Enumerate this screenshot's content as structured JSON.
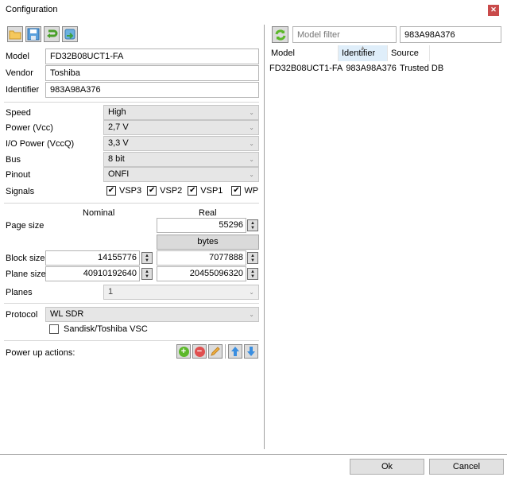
{
  "window": {
    "title": "Configuration",
    "close_icon": "close-icon"
  },
  "toolbar": {
    "buttons": [
      {
        "name": "open-button",
        "icon": "folder-open-icon"
      },
      {
        "name": "save-button",
        "icon": "floppy-disk-icon"
      },
      {
        "name": "reload-button",
        "icon": "undo-arrow-icon"
      },
      {
        "name": "import-button",
        "icon": "database-import-icon"
      }
    ]
  },
  "identity": {
    "model_label": "Model",
    "model_value": "FD32B08UCT1-FA",
    "vendor_label": "Vendor",
    "vendor_value": "Toshiba",
    "identifier_label": "Identifier",
    "identifier_value": "983A98A376"
  },
  "settings": {
    "speed_label": "Speed",
    "speed_value": "High",
    "power_label": "Power (Vcc)",
    "power_value": "2,7 V",
    "io_power_label": "I/O Power (VccQ)",
    "io_power_value": "3,3 V",
    "bus_label": "Bus",
    "bus_value": "8 bit",
    "pinout_label": "Pinout",
    "pinout_value": "ONFI",
    "signals_label": "Signals",
    "signals": [
      {
        "label": "VSP3",
        "checked": true
      },
      {
        "label": "VSP2",
        "checked": true
      },
      {
        "label": "VSP1",
        "checked": true
      },
      {
        "label": "WP",
        "checked": true
      }
    ]
  },
  "geometry": {
    "nominal_header": "Nominal",
    "real_header": "Real",
    "page_size_label": "Page size",
    "page_size_real": "55296",
    "unit_button": "bytes",
    "block_size_label": "Block size",
    "block_size_nominal": "14155776",
    "block_size_real": "7077888",
    "plane_size_label": "Plane size",
    "plane_size_nominal": "40910192640",
    "plane_size_real": "20455096320",
    "planes_label": "Planes",
    "planes_value": "1"
  },
  "protocol": {
    "label": "Protocol",
    "value": "WL SDR",
    "vsc_label": "Sandisk/Toshiba VSC",
    "vsc_checked": false
  },
  "power_up": {
    "label": "Power up actions:",
    "buttons": [
      "add-icon",
      "remove-icon",
      "edit-pencil-icon",
      "arrow-up-icon",
      "arrow-down-icon"
    ]
  },
  "database": {
    "refresh_icon": "refresh-icon",
    "model_filter_placeholder": "Model filter",
    "identifier_filter_value": "983A98A376",
    "columns": [
      "Model",
      "Identifier",
      "Source"
    ],
    "sorted_column": "Identifier",
    "rows": [
      {
        "model": "FD32B08UCT1-FA",
        "identifier": "983A98A376",
        "source": "Trusted DB"
      }
    ]
  },
  "footer": {
    "ok_label": "Ok",
    "cancel_label": "Cancel"
  }
}
